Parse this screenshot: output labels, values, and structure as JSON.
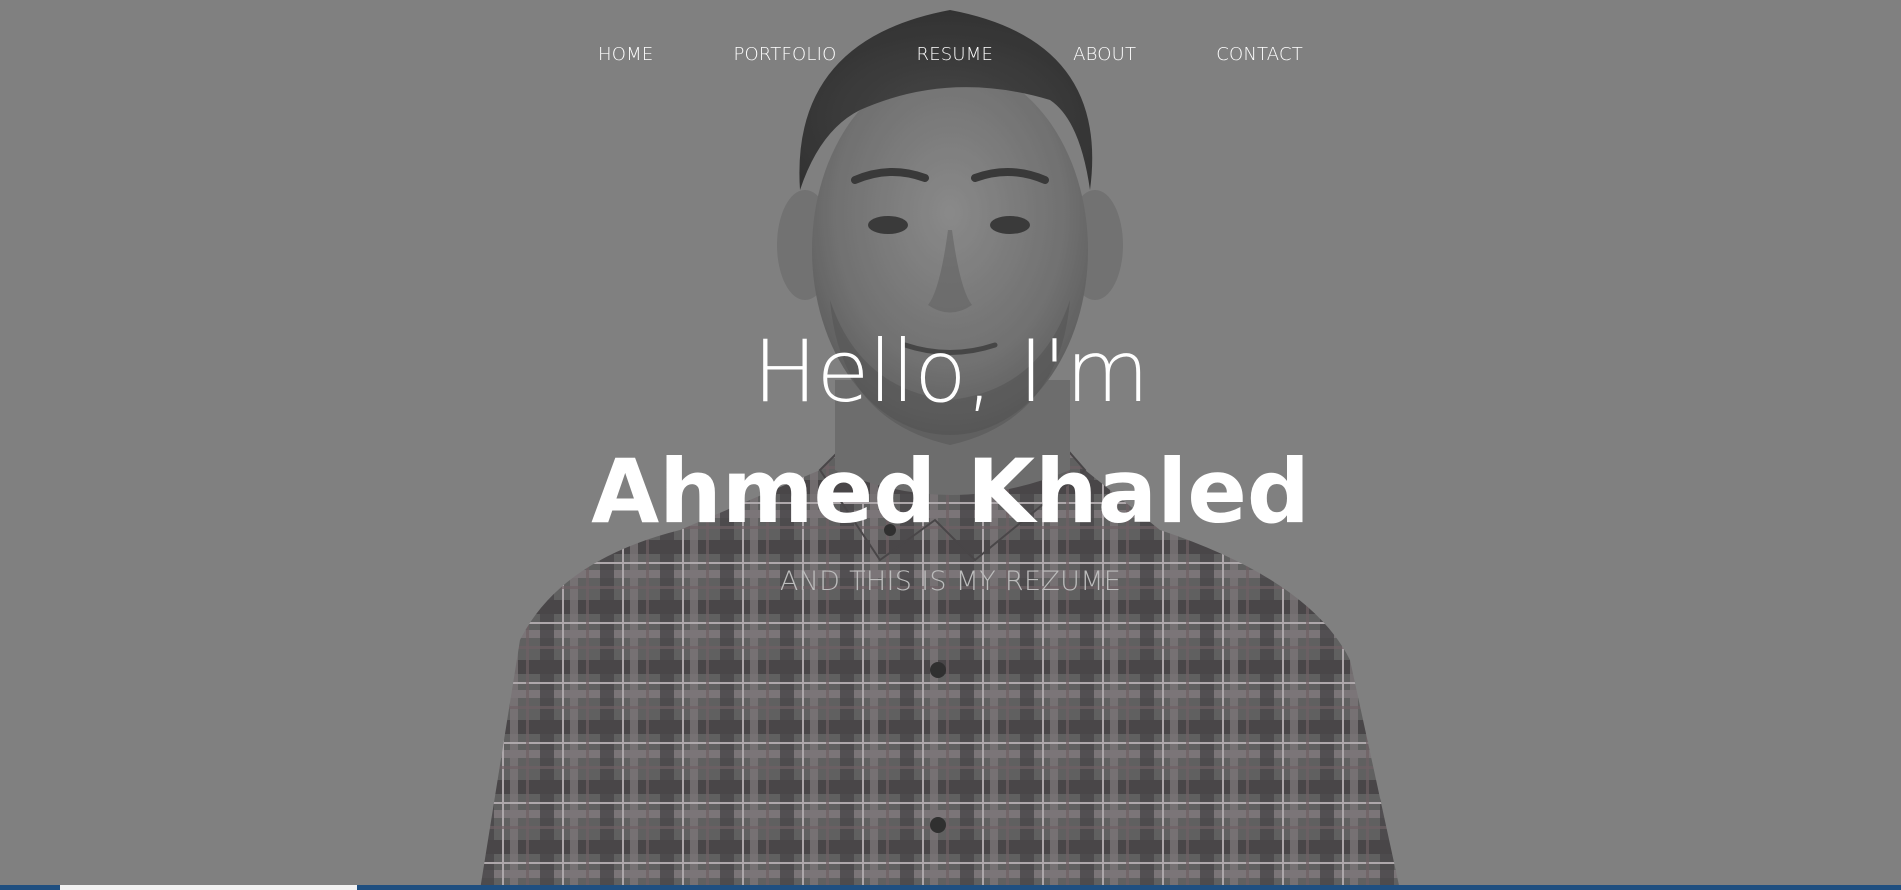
{
  "nav": {
    "items": [
      {
        "label": "HOME"
      },
      {
        "label": "PORTFOLIO"
      },
      {
        "label": "RESUME"
      },
      {
        "label": "ABOUT"
      },
      {
        "label": "CONTACT"
      }
    ]
  },
  "hero": {
    "greeting": "Hello, I'm",
    "name": "Ahmed Khaled",
    "tagline": "AND THIS IS MY REZUME"
  },
  "scroll_indicator": {
    "progress": 0.156
  },
  "colors": {
    "background": "#808080",
    "text": "#ffffff",
    "tagline": "#bcbcbc",
    "bar": "#1f4f80",
    "bar_progress": "#f2f2f2"
  }
}
